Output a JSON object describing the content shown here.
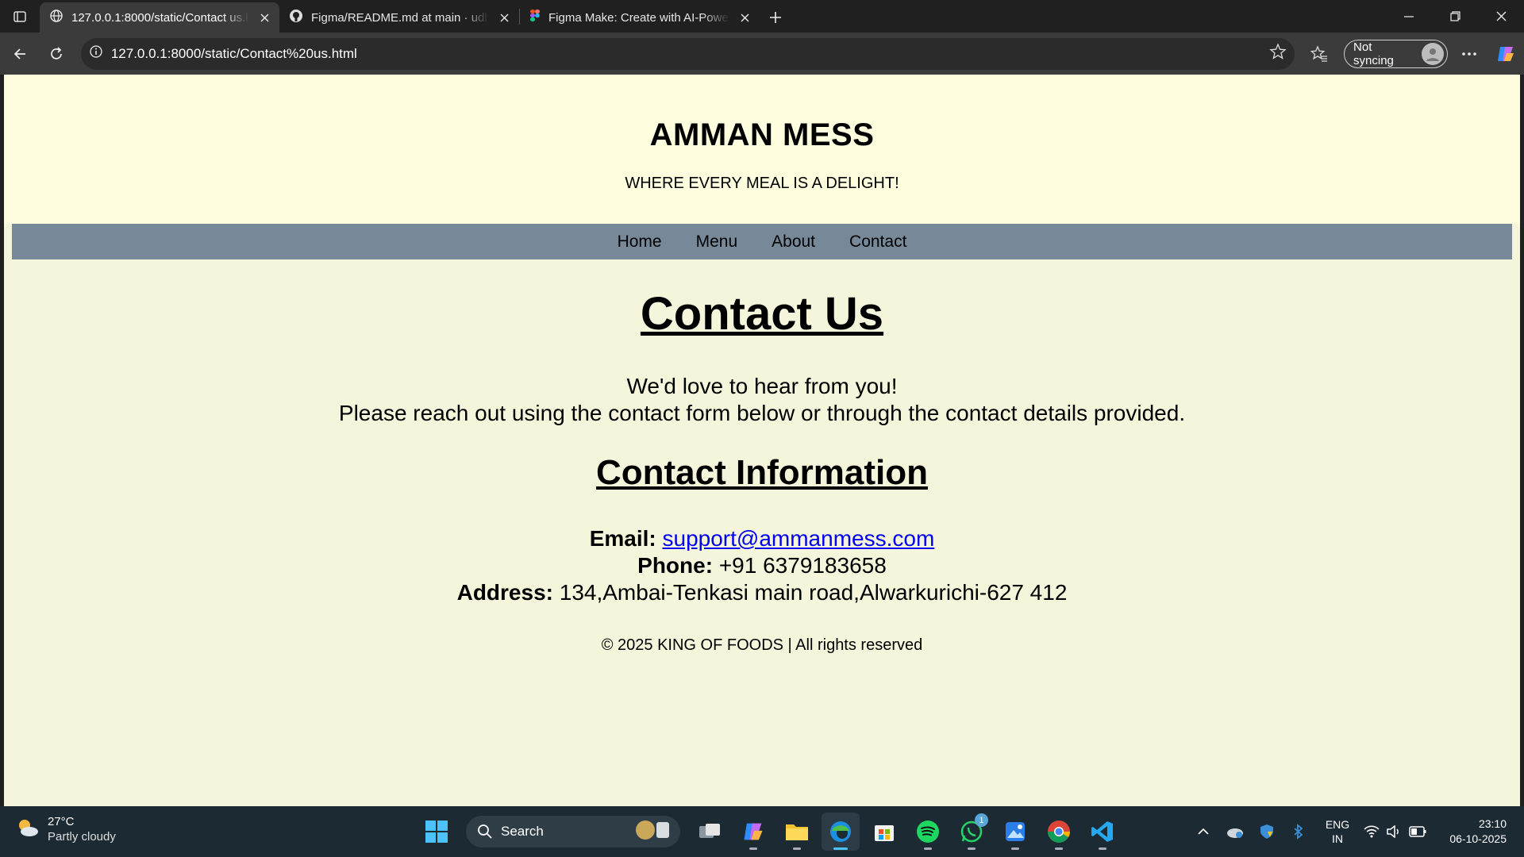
{
  "browser": {
    "tabs": [
      {
        "title": "127.0.0.1:8000/static/Contact us.h",
        "active": true,
        "icon": "globe-icon"
      },
      {
        "title": "Figma/README.md at main · udh",
        "active": false,
        "icon": "github-icon"
      },
      {
        "title": "Figma Make: Create with AI-Powe",
        "active": false,
        "icon": "figma-icon"
      }
    ],
    "url": "127.0.0.1:8000/static/Contact%20us.html",
    "profile_label": "Not syncing"
  },
  "site": {
    "title": "AMMAN MESS",
    "tagline": "WHERE EVERY MEAL IS A DELIGHT!",
    "nav": [
      "Home",
      "Menu",
      "About",
      "Contact"
    ],
    "colors": {
      "header_bg": "#ffffe0",
      "nav_bg": "#778899",
      "page_bg": "#f5f5dc",
      "link": "#0000ee"
    }
  },
  "main": {
    "heading": "Contact Us",
    "intro_line1": "We'd love to hear from you!",
    "intro_line2": "Please reach out using the contact form below or through the contact details provided.",
    "info_heading": "Contact Information",
    "email_label": "Email:",
    "email_value": "support@ammanmess.com",
    "phone_label": "Phone:",
    "phone_value": "+91 6379183658",
    "address_label": "Address:",
    "address_value": "134,Ambai-Tenkasi main road,Alwarkurichi-627 412",
    "footer": "© 2025 KING OF FOODS | All rights reserved"
  },
  "taskbar": {
    "weather_temp": "27°C",
    "weather_cond": "Partly cloudy",
    "search_label": "Search",
    "lang_line1": "ENG",
    "lang_line2": "IN",
    "time": "23:10",
    "date": "06-10-2025",
    "whatsapp_badge": "1"
  }
}
